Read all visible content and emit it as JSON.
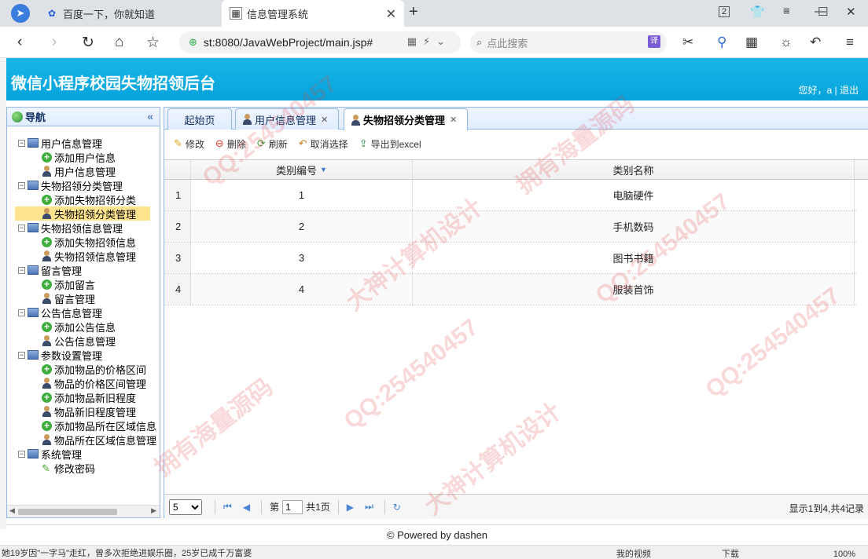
{
  "browser": {
    "tabs": [
      {
        "label": "百度一下，你就知道"
      },
      {
        "label": "信息管理系统"
      }
    ],
    "url": "st:8080/JavaWebProject/main.jsp#",
    "search_placeholder": "点此搜索",
    "translate_label": "译",
    "tab_count": "2"
  },
  "app": {
    "title": "微信小程序校园失物招领后台",
    "greeting": "您好，a | ",
    "logout": "退出"
  },
  "sidebar": {
    "title": "导航",
    "nodes": [
      {
        "label": "用户信息管理"
      },
      {
        "label": "添加用户信息"
      },
      {
        "label": "用户信息管理"
      },
      {
        "label": "失物招领分类管理"
      },
      {
        "label": "添加失物招领分类"
      },
      {
        "label": "失物招领分类管理"
      },
      {
        "label": "失物招领信息管理"
      },
      {
        "label": "添加失物招领信息"
      },
      {
        "label": "失物招领信息管理"
      },
      {
        "label": "留言管理"
      },
      {
        "label": "添加留言"
      },
      {
        "label": "留言管理"
      },
      {
        "label": "公告信息管理"
      },
      {
        "label": "添加公告信息"
      },
      {
        "label": "公告信息管理"
      },
      {
        "label": "参数设置管理"
      },
      {
        "label": "添加物品的价格区间"
      },
      {
        "label": "物品的价格区间管理"
      },
      {
        "label": "添加物品新旧程度"
      },
      {
        "label": "物品新旧程度管理"
      },
      {
        "label": "添加物品所在区域信息"
      },
      {
        "label": "物品所在区域信息管理"
      },
      {
        "label": "系统管理"
      },
      {
        "label": "修改密码"
      }
    ]
  },
  "tabs": [
    {
      "label": "起始页"
    },
    {
      "label": "用户信息管理"
    },
    {
      "label": "失物招领分类管理"
    }
  ],
  "toolbar": {
    "edit": "修改",
    "delete": "删除",
    "refresh": "刷新",
    "cancel": "取消选择",
    "export": "导出到excel"
  },
  "grid": {
    "headers": {
      "id": "类别编号",
      "name": "类别名称"
    },
    "rows": [
      {
        "idx": "1",
        "id": "1",
        "name": "电脑硬件"
      },
      {
        "idx": "2",
        "id": "2",
        "name": "手机数码"
      },
      {
        "idx": "3",
        "id": "3",
        "name": "图书书籍"
      },
      {
        "idx": "4",
        "id": "4",
        "name": "服装首饰"
      }
    ]
  },
  "pager": {
    "page_size": "5",
    "page_prefix": "第",
    "page_value": "1",
    "page_total": "共1页",
    "info": "显示1到4,共4记录"
  },
  "footer": "© Powered by dashen",
  "status": {
    "news": "她19岁因\"一字马\"走红，曾多次拒绝进娱乐圈，25岁已成千万富婆",
    "video": "我的视频",
    "download": "下载",
    "zoom": "100%"
  },
  "watermarks": [
    "QQ:254540457",
    "大神计算机设计",
    "拥有海量源码"
  ],
  "colors": {
    "header_bg": "#06a3dc",
    "panel_border": "#95b8e7",
    "selected_node": "#ffe48d"
  }
}
